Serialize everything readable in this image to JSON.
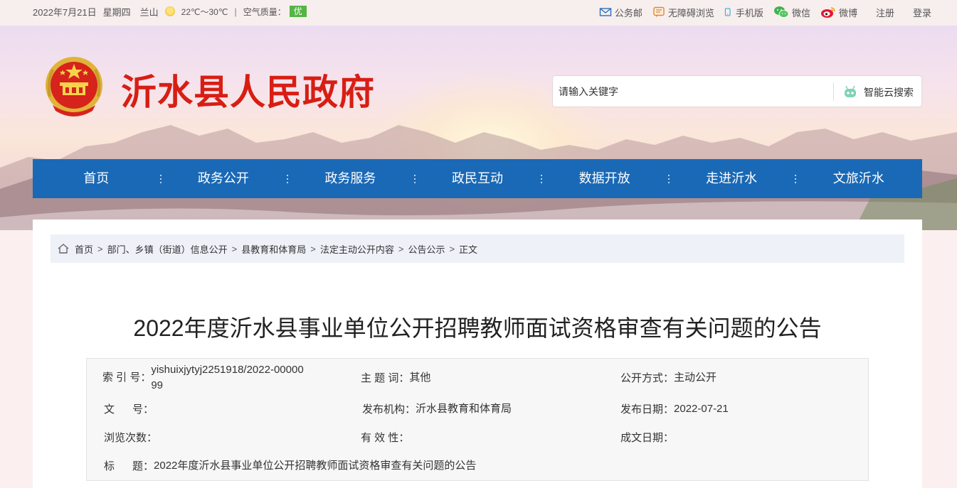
{
  "topbar": {
    "date": "2022年7月21日",
    "weekday": "星期四",
    "city": "兰山",
    "temperature": "22℃～30℃",
    "divider": "|",
    "air_quality_label": "空气质量：",
    "air_quality_value": "优",
    "links": {
      "email": "公务邮",
      "accessibility": "无障碍浏览",
      "mobile": "手机版",
      "wechat": "微信",
      "weibo": "微博",
      "register": "注册",
      "login": "登录"
    }
  },
  "header": {
    "site_title": "沂水县人民政府",
    "search_placeholder": "请输入关键字",
    "search_button": "智能云搜索"
  },
  "nav": {
    "items": [
      "首页",
      "政务公开",
      "政务服务",
      "政民互动",
      "数据开放",
      "走进沂水",
      "文旅沂水"
    ]
  },
  "breadcrumb": {
    "separator": ">",
    "items": [
      "首页",
      "部门、乡镇（街道）信息公开",
      "县教育和体育局",
      "法定主动公开内容",
      "公告公示",
      "正文"
    ]
  },
  "article": {
    "title": "2022年度沂水县事业单位公开招聘教师面试资格审查有关问题的公告"
  },
  "meta": {
    "index_label": "索 引 号：",
    "index_value": "yishuixjytyj2251918/2022-0000099",
    "subject_label": "主 题 词：",
    "subject_value": "其他",
    "disclosure_label": "公开方式：",
    "disclosure_value": "主动公开",
    "doc_no_label": "文      号：",
    "doc_no_value": "",
    "issuer_label": "发布机构：",
    "issuer_value": "沂水县教育和体育局",
    "pub_date_label": "发布日期：",
    "pub_date_value": "2022-07-21",
    "views_label": "浏览次数：",
    "views_value": "",
    "validity_label": "有 效 性：",
    "validity_value": "",
    "written_date_label": "成文日期：",
    "written_date_value": "",
    "title_label": "标      题：",
    "title_value": "2022年度沂水县事业单位公开招聘教师面试资格审查有关问题的公告"
  },
  "colors": {
    "nav_bg": "#1a69b6",
    "title_red": "#d81e14",
    "aqi_green": "#55b544"
  }
}
